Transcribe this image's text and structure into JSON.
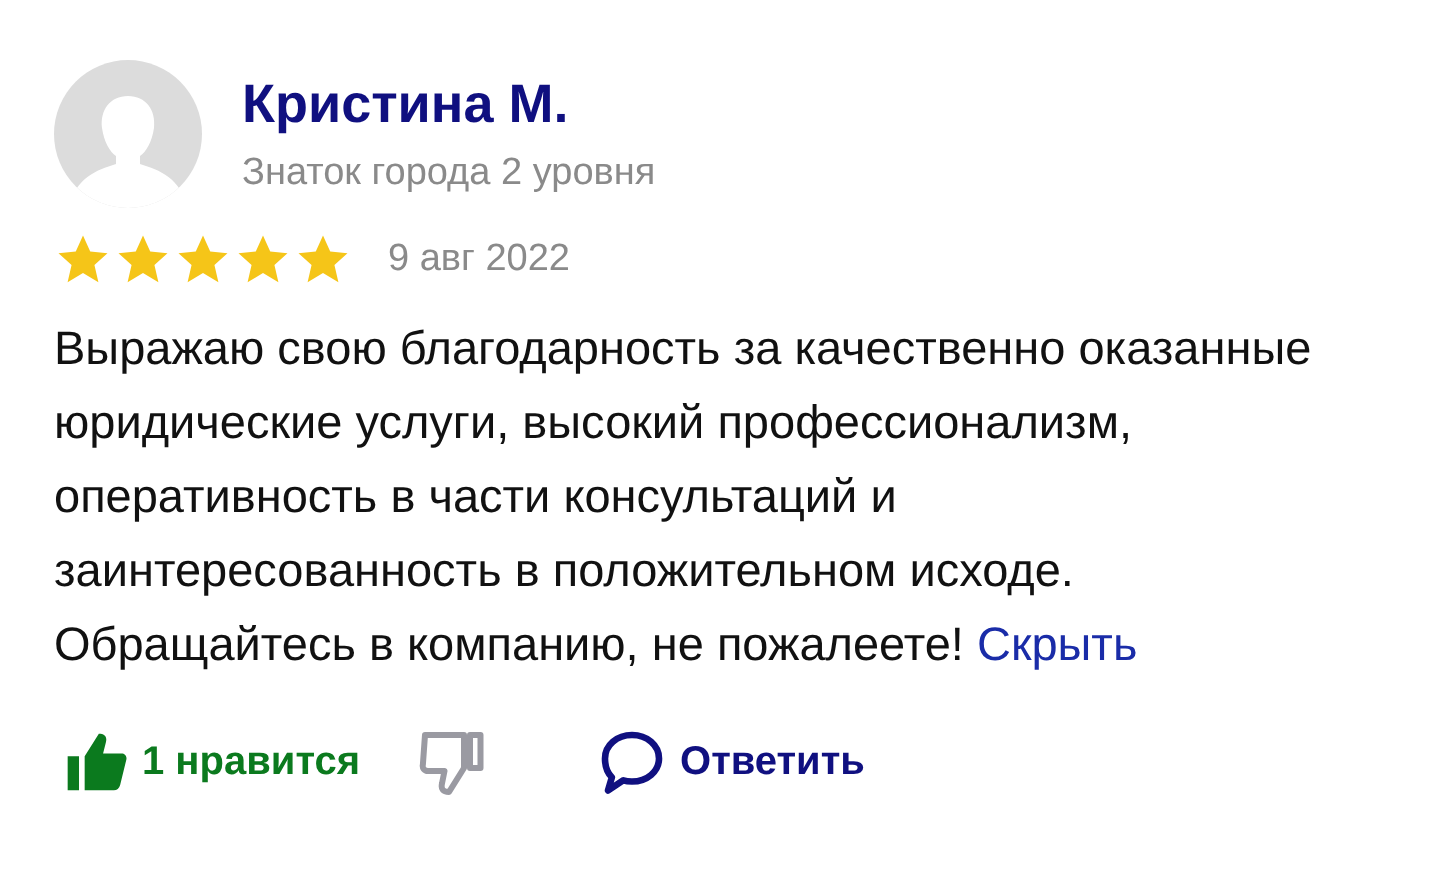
{
  "review": {
    "author": "Кристина М.",
    "badge": "Знаток города 2 уровня",
    "stars": 5,
    "date": "9 авг 2022",
    "text": "Выражаю свою благодарность за качественно оказанные юридические услуги, высокий профессионализм, оперативность в части консультаций и заинтересованность в положительном исходе. Обращайтесь в компанию, не пожалеете!",
    "collapse_link": "Скрыть"
  },
  "actions": {
    "like": {
      "label": "1 нравится",
      "liked": true
    },
    "dislike": {
      "disliked": false
    },
    "reply": {
      "label": "Ответить"
    }
  }
}
